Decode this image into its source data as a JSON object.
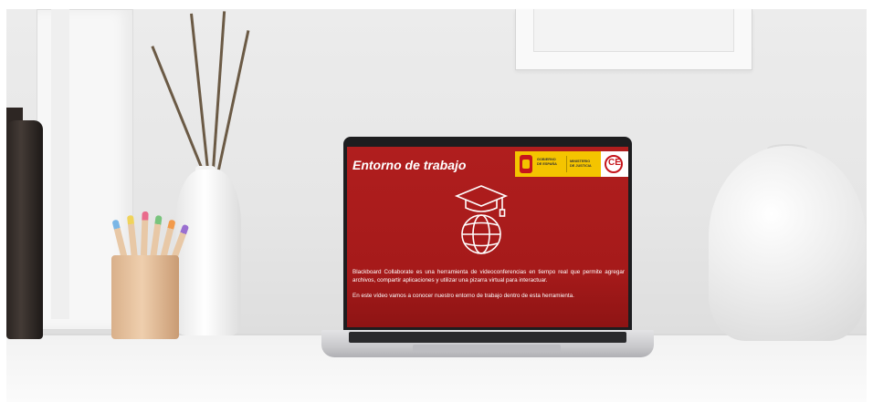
{
  "slide": {
    "title": "Entorno de trabajo",
    "logo_gobierno_line1": "GOBIERNO",
    "logo_gobierno_line2": "DE ESPAÑA",
    "logo_ministerio_line1": "MINISTERIO",
    "logo_ministerio_line2": "DE JUSTICIA",
    "logo_ce": "CE",
    "paragraph_1": "Blackboard Collaborate es una herramienta de videoconferencias en tiempo real que permite agregar archivos, compartir aplicaciones y utilizar una pizarra virtual para interactuar.",
    "paragraph_2": "En este vídeo vamos a conocer nuestro entorno de trabajo dentro de esta herramienta.",
    "icon": "graduation-globe-icon"
  },
  "colors": {
    "slide_background": "#b01e1e",
    "logo_yellow": "#f4c400",
    "logo_red": "#c6151c"
  }
}
